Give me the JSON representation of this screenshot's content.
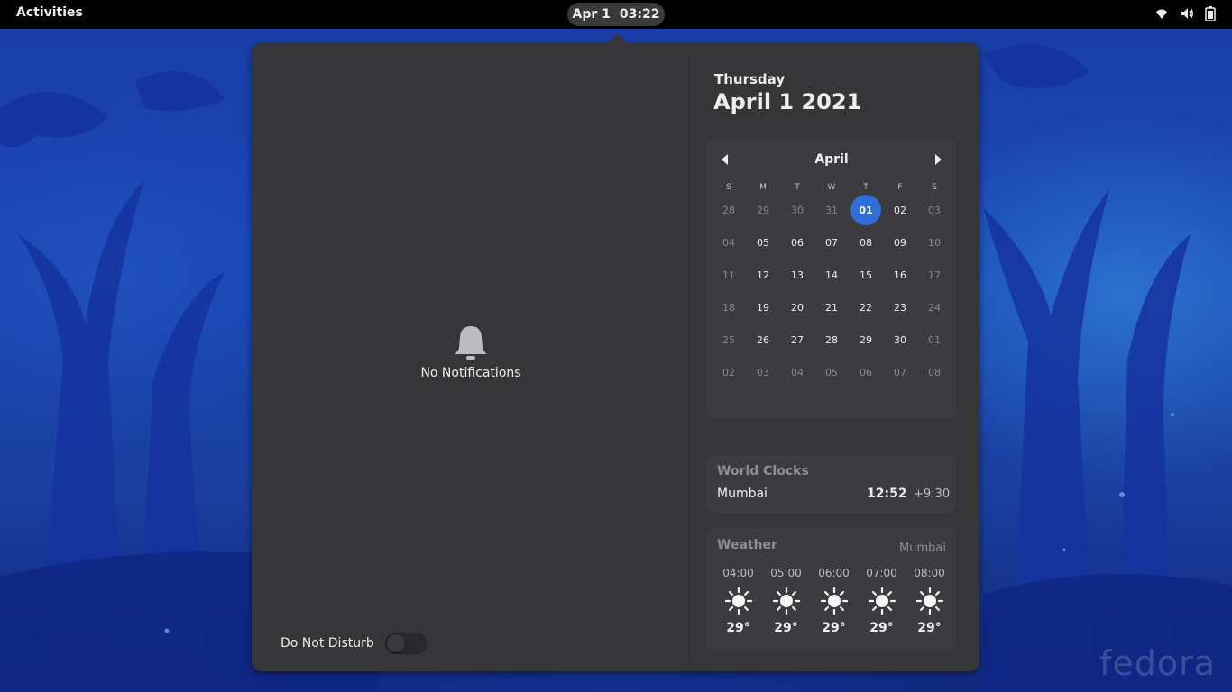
{
  "topbar": {
    "activities": "Activities",
    "clock_date": "Apr 1",
    "clock_time": "03:22",
    "tray_icons": [
      "wifi-icon",
      "volume-icon",
      "battery-icon"
    ]
  },
  "notifications": {
    "empty_label": "No Notifications",
    "dnd_label": "Do Not Disturb",
    "dnd_enabled": false
  },
  "date_header": {
    "weekday": "Thursday",
    "full_date": "April 1 2021"
  },
  "calendar": {
    "month": "April",
    "weekday_headers": [
      "S",
      "M",
      "T",
      "W",
      "T",
      "F",
      "S"
    ],
    "weeks": [
      [
        {
          "d": "28",
          "dim": true
        },
        {
          "d": "29",
          "dim": true
        },
        {
          "d": "30",
          "dim": true
        },
        {
          "d": "31",
          "dim": true
        },
        {
          "d": "01",
          "today": true
        },
        {
          "d": "02"
        },
        {
          "d": "03",
          "dim": true
        }
      ],
      [
        {
          "d": "04",
          "dim": true
        },
        {
          "d": "05"
        },
        {
          "d": "06"
        },
        {
          "d": "07"
        },
        {
          "d": "08"
        },
        {
          "d": "09"
        },
        {
          "d": "10",
          "dim": true
        }
      ],
      [
        {
          "d": "11",
          "dim": true
        },
        {
          "d": "12"
        },
        {
          "d": "13"
        },
        {
          "d": "14"
        },
        {
          "d": "15"
        },
        {
          "d": "16"
        },
        {
          "d": "17",
          "dim": true
        }
      ],
      [
        {
          "d": "18",
          "dim": true
        },
        {
          "d": "19"
        },
        {
          "d": "20"
        },
        {
          "d": "21"
        },
        {
          "d": "22"
        },
        {
          "d": "23"
        },
        {
          "d": "24",
          "dim": true
        }
      ],
      [
        {
          "d": "25",
          "dim": true
        },
        {
          "d": "26"
        },
        {
          "d": "27"
        },
        {
          "d": "28"
        },
        {
          "d": "29"
        },
        {
          "d": "30"
        },
        {
          "d": "01",
          "dim": true
        }
      ],
      [
        {
          "d": "02",
          "dim": true
        },
        {
          "d": "03",
          "dim": true
        },
        {
          "d": "04",
          "dim": true
        },
        {
          "d": "05",
          "dim": true
        },
        {
          "d": "06",
          "dim": true
        },
        {
          "d": "07",
          "dim": true
        },
        {
          "d": "08",
          "dim": true
        }
      ]
    ]
  },
  "world_clocks": {
    "title": "World Clocks",
    "city": "Mumbai",
    "time": "12:52",
    "offset": "+9:30"
  },
  "weather": {
    "title": "Weather",
    "location": "Mumbai",
    "forecast": [
      {
        "time": "04:00",
        "icon": "sun-icon",
        "temp": "29°"
      },
      {
        "time": "05:00",
        "icon": "sun-icon",
        "temp": "29°"
      },
      {
        "time": "06:00",
        "icon": "sun-icon",
        "temp": "29°"
      },
      {
        "time": "07:00",
        "icon": "sun-icon",
        "temp": "29°"
      },
      {
        "time": "08:00",
        "icon": "sun-icon",
        "temp": "29°"
      }
    ]
  },
  "wallpaper": {
    "watermark": "fedora"
  },
  "colors": {
    "accent": "#2f6ed6",
    "topbar": "#000000",
    "popover": "#363538",
    "card": "#3c3b3f"
  }
}
